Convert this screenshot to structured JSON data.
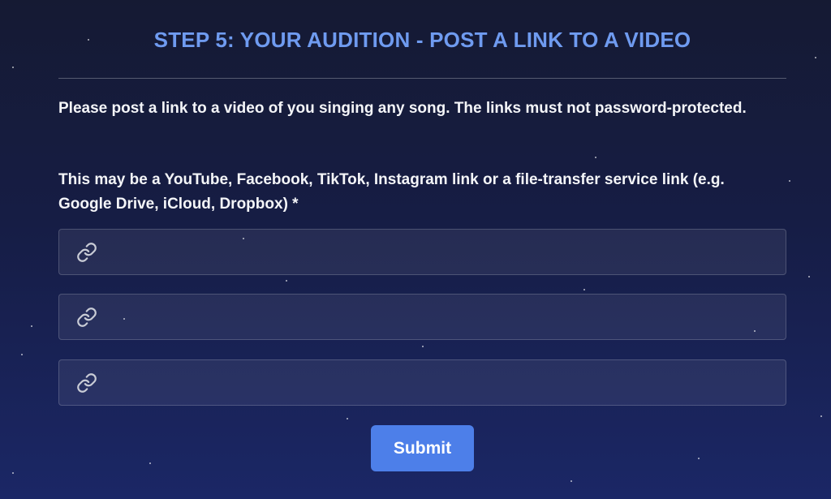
{
  "form": {
    "heading": "STEP 5: YOUR AUDITION - POST A LINK TO A VIDEO",
    "instructions": "Please post a link to a video of you singing any song. The links must not password-protected.",
    "sources_note": "This may be a YouTube, Facebook, TikTok, Instagram link or a file-transfer service link (e.g. Google Drive, iCloud, Dropbox) *",
    "link_fields": [
      {
        "icon": "link-icon",
        "value": "",
        "placeholder": ""
      },
      {
        "icon": "link-icon",
        "value": "",
        "placeholder": ""
      },
      {
        "icon": "link-icon",
        "value": "",
        "placeholder": ""
      }
    ],
    "submit_label": "Submit"
  },
  "colors": {
    "heading": "#6f9bf0",
    "button": "#4d7fe9",
    "background_top": "#151a33",
    "background_bottom": "#1b2766"
  }
}
